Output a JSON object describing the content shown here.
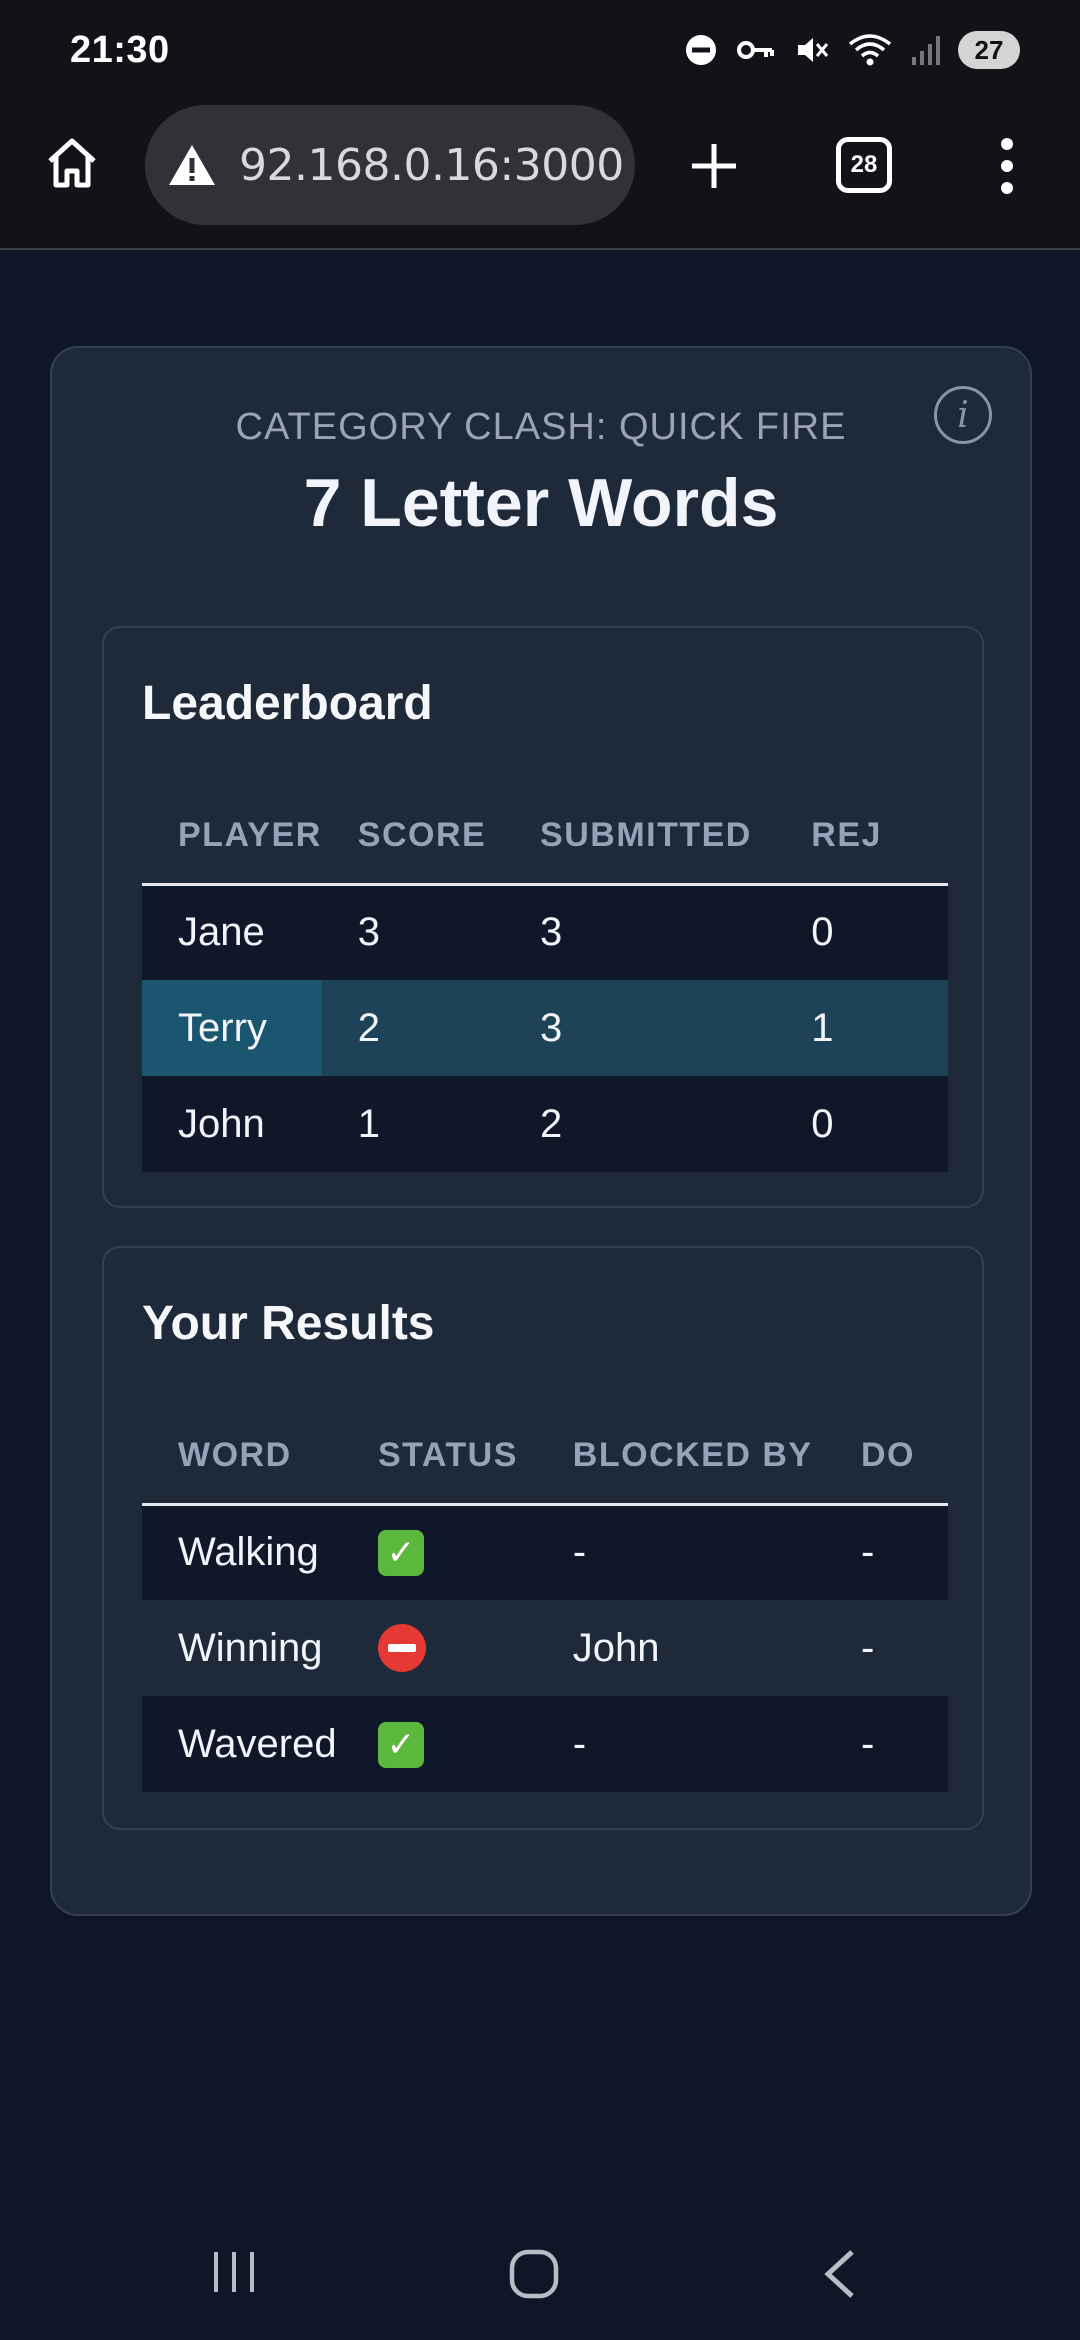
{
  "status_bar": {
    "time": "21:30",
    "battery": "27",
    "icons": [
      "do-not-disturb-icon",
      "vpn-key-icon",
      "mute-icon",
      "wifi-icon",
      "signal-icon"
    ]
  },
  "browser": {
    "url": "92.168.0.16:3000",
    "tab_count": "28",
    "icons": [
      "home-icon",
      "insecure-warning-icon",
      "plus-icon",
      "tabs-icon",
      "more-vert-icon"
    ]
  },
  "game": {
    "mode": "CATEGORY CLASH: QUICK FIRE",
    "title": "7 Letter Words",
    "info_icon": "i"
  },
  "leaderboard": {
    "title": "Leaderboard",
    "columns": [
      "PLAYER",
      "SCORE",
      "SUBMITTED",
      "REJ"
    ],
    "rows": [
      {
        "player": "Jane",
        "score": "3",
        "submitted": "3",
        "rejected": "0"
      },
      {
        "player": "Terry",
        "score": "2",
        "submitted": "3",
        "rejected": "1"
      },
      {
        "player": "John",
        "score": "1",
        "submitted": "2",
        "rejected": "0"
      }
    ],
    "highlighted_player": "Terry"
  },
  "results": {
    "title": "Your Results",
    "columns": [
      "WORD",
      "STATUS",
      "BLOCKED BY",
      "DO"
    ],
    "rows": [
      {
        "word": "Walking",
        "status": "accepted",
        "status_icon": "check-mark-icon",
        "blocked_by": "-",
        "extra": "-"
      },
      {
        "word": "Winning",
        "status": "blocked",
        "status_icon": "no-entry-icon",
        "blocked_by": "John",
        "extra": "-"
      },
      {
        "word": "Wavered",
        "status": "accepted",
        "status_icon": "check-mark-icon",
        "blocked_by": "-",
        "extra": "-"
      }
    ]
  },
  "colors": {
    "page_bg": "#0e1627",
    "card_bg": "#1e293a",
    "row_dark": "#0f1729",
    "highlight": "#1e4257",
    "highlight_name": "#1b5670"
  }
}
